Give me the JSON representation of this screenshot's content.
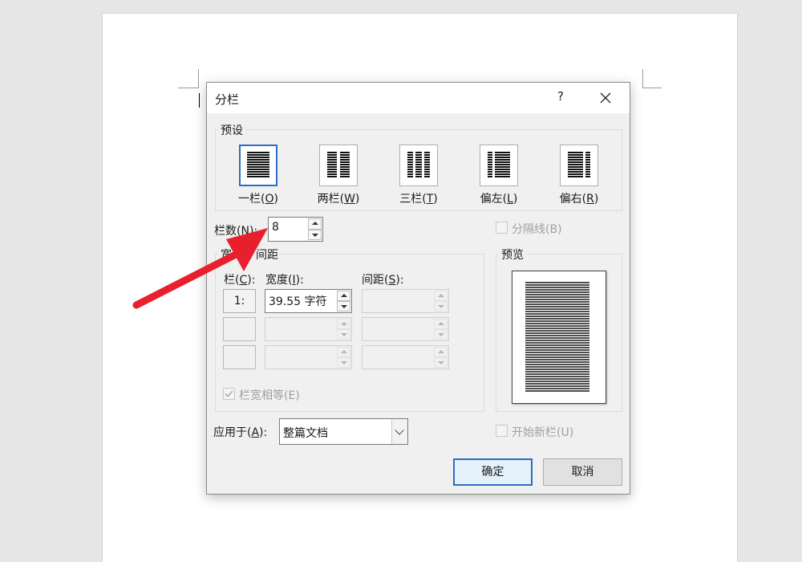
{
  "dialog": {
    "title": "分栏",
    "help_label": "?",
    "presets_group_label": "预设",
    "presets": [
      {
        "label": "一栏(",
        "key": "O",
        "tail": ")",
        "icon": "one-column-icon",
        "selected": true
      },
      {
        "label": "两栏(",
        "key": "W",
        "tail": ")",
        "icon": "two-columns-icon",
        "selected": false
      },
      {
        "label": "三栏(",
        "key": "T",
        "tail": ")",
        "icon": "three-columns-icon",
        "selected": false
      },
      {
        "label": "偏左(",
        "key": "L",
        "tail": ")",
        "icon": "left-column-icon",
        "selected": false
      },
      {
        "label": "偏右(",
        "key": "R",
        "tail": ")",
        "icon": "right-column-icon",
        "selected": false
      }
    ],
    "column_count": {
      "label": "栏数(",
      "key": "N",
      "tail": "):",
      "value": "8"
    },
    "separator_line": {
      "label": "分隔线(B)",
      "checked": false
    },
    "width_spacing_group": {
      "label_start": "宽",
      "label_end": "间距",
      "col_header": {
        "label": "栏(",
        "key": "C",
        "tail": "):"
      },
      "width_header": {
        "label": "宽度(",
        "key": "I",
        "tail": "):"
      },
      "spacing_header": {
        "label": "间距(",
        "key": "S",
        "tail": "):"
      },
      "rows": [
        {
          "col": "1:",
          "width": "39.55 字符",
          "spacing": ""
        },
        {
          "col": "",
          "width": "",
          "spacing": ""
        },
        {
          "col": "",
          "width": "",
          "spacing": ""
        }
      ],
      "equal_width": {
        "label": "栏宽相等(E)",
        "checked": true
      }
    },
    "preview_group_label": "预览",
    "apply_to": {
      "label": "应用于(",
      "key": "A",
      "tail": "):",
      "value": "整篇文档"
    },
    "start_new_column": {
      "label": "开始新栏(U)",
      "checked": false
    },
    "ok_label": "确定",
    "cancel_label": "取消"
  },
  "colors": {
    "accent": "#2b6fc3",
    "annotation_arrow": "#e8202e"
  }
}
